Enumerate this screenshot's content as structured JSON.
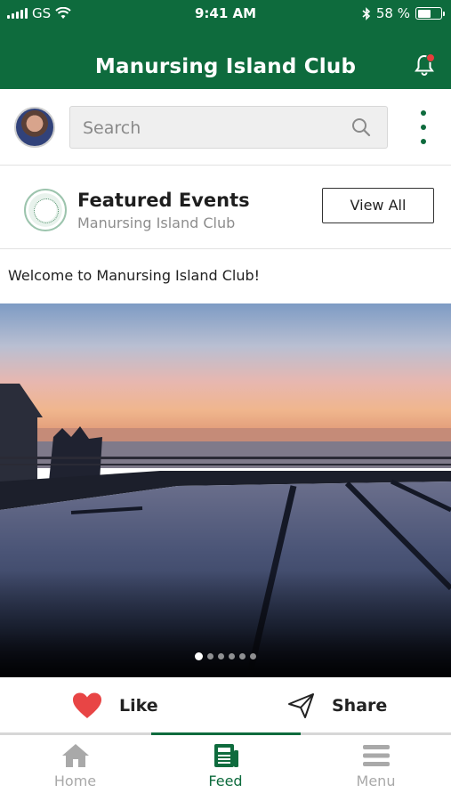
{
  "status_bar": {
    "carrier": "GS",
    "time": "9:41 AM",
    "battery_percent": "58 %",
    "battery_level": 0.58
  },
  "header": {
    "title": "Manursing Island Club",
    "notification_badge": true
  },
  "search": {
    "placeholder": "Search"
  },
  "featured": {
    "title": "Featured Events",
    "subtitle": "Manursing Island Club",
    "view_all_label": "View All"
  },
  "post": {
    "text": "Welcome to Manursing Island Club!",
    "carousel_count": 6,
    "carousel_active": 0
  },
  "actions": {
    "like_label": "Like",
    "share_label": "Share"
  },
  "tabs": [
    {
      "label": "Home",
      "icon": "home-icon",
      "active": false
    },
    {
      "label": "Feed",
      "icon": "newspaper-icon",
      "active": true
    },
    {
      "label": "Menu",
      "icon": "hamburger-icon",
      "active": false
    }
  ],
  "colors": {
    "brand": "#0e6b3d",
    "like": "#e84545",
    "inactive": "#a9a9a9"
  }
}
